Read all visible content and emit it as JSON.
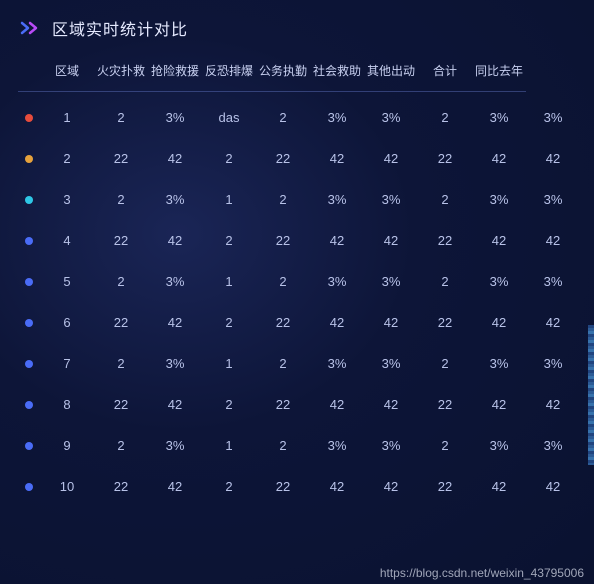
{
  "title": "区域实时统计对比",
  "columns": [
    "区域",
    "火灾扑救",
    "抢险救援",
    "反恐排爆",
    "公务执勤",
    "社会救助",
    "其他出动",
    "合计",
    "同比去年"
  ],
  "dot_colors": [
    "#e74c3c",
    "#e6a23c",
    "#2ec7e6",
    "#4a6cf7",
    "#4a6cf7",
    "#4a6cf7",
    "#4a6cf7",
    "#4a6cf7",
    "#4a6cf7",
    "#4a6cf7"
  ],
  "rows": [
    [
      "1",
      "2",
      "3%",
      "das",
      "2",
      "3%",
      "3%",
      "2",
      "3%",
      "3%"
    ],
    [
      "2",
      "22",
      "42",
      "2",
      "22",
      "42",
      "42",
      "22",
      "42",
      "42"
    ],
    [
      "3",
      "2",
      "3%",
      "1",
      "2",
      "3%",
      "3%",
      "2",
      "3%",
      "3%"
    ],
    [
      "4",
      "22",
      "42",
      "2",
      "22",
      "42",
      "42",
      "22",
      "42",
      "42"
    ],
    [
      "5",
      "2",
      "3%",
      "1",
      "2",
      "3%",
      "3%",
      "2",
      "3%",
      "3%"
    ],
    [
      "6",
      "22",
      "42",
      "2",
      "22",
      "42",
      "42",
      "22",
      "42",
      "42"
    ],
    [
      "7",
      "2",
      "3%",
      "1",
      "2",
      "3%",
      "3%",
      "2",
      "3%",
      "3%"
    ],
    [
      "8",
      "22",
      "42",
      "2",
      "22",
      "42",
      "42",
      "22",
      "42",
      "42"
    ],
    [
      "9",
      "2",
      "3%",
      "1",
      "2",
      "3%",
      "3%",
      "2",
      "3%",
      "3%"
    ],
    [
      "10",
      "22",
      "42",
      "2",
      "22",
      "42",
      "42",
      "22",
      "42",
      "42"
    ]
  ],
  "watermark": "https://blog.csdn.net/weixin_43795006"
}
